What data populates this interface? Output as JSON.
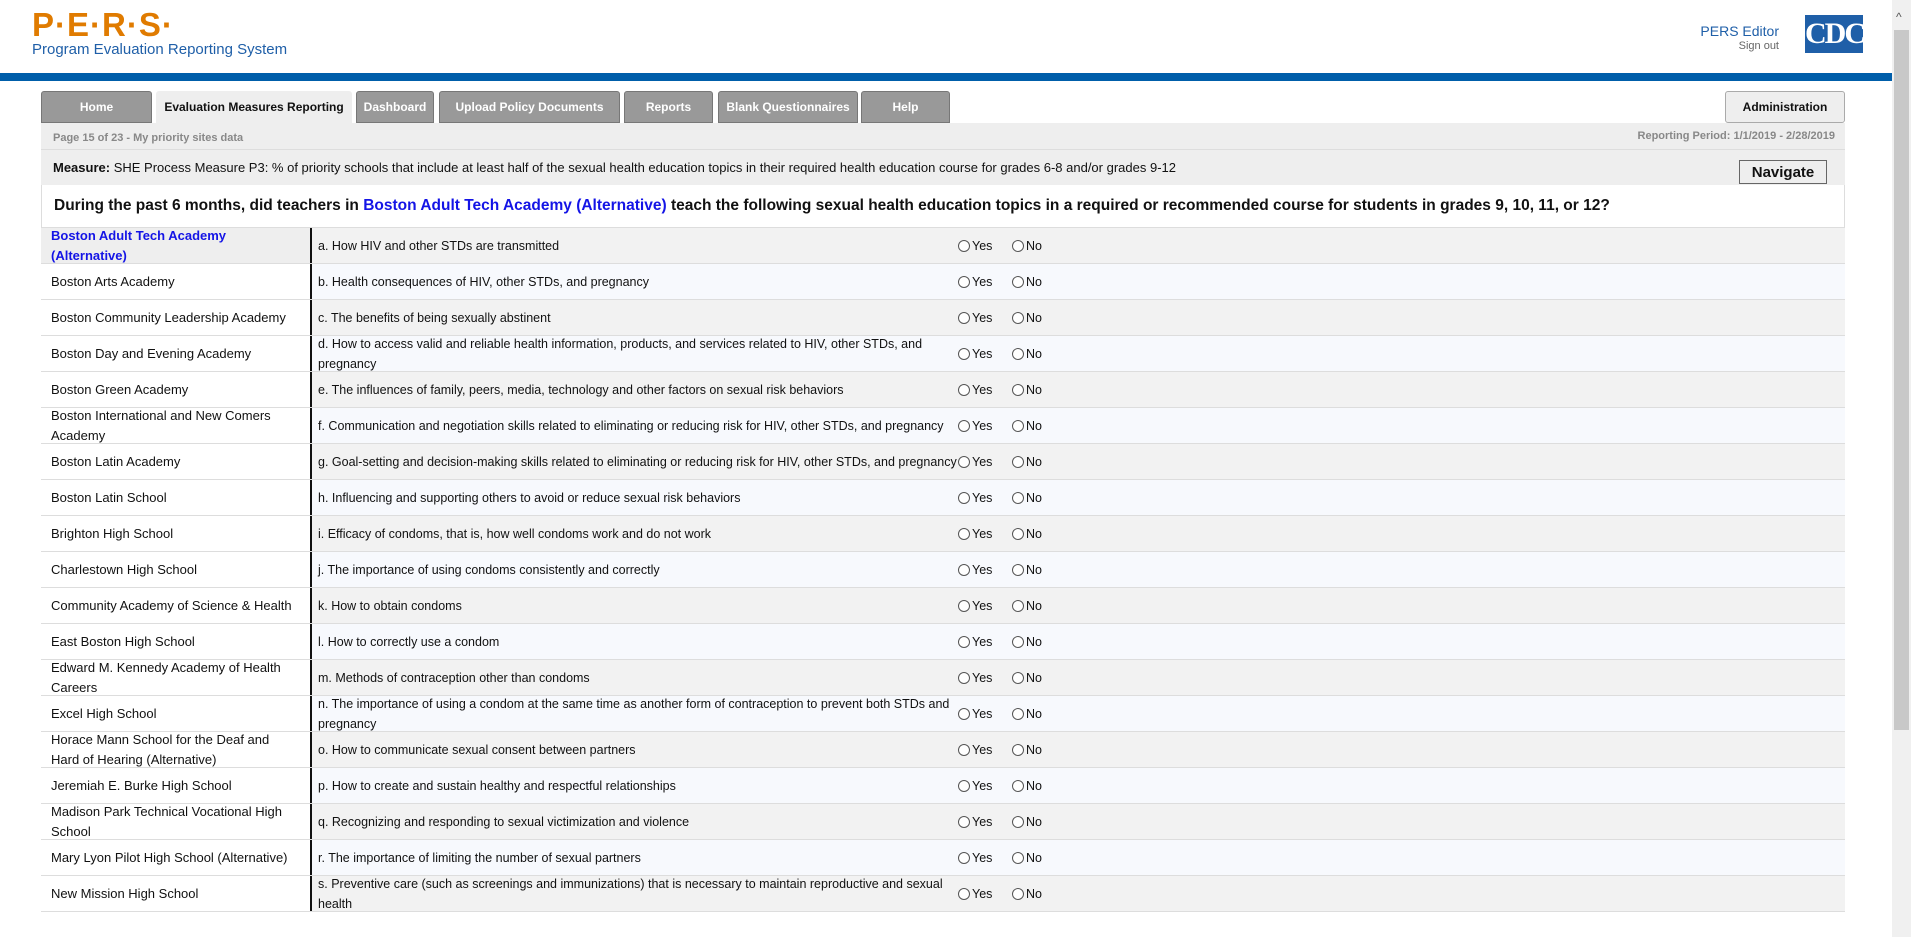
{
  "header": {
    "logo": "P·E·R·S·",
    "subtitle": "Program Evaluation Reporting System",
    "user": "PERS Editor",
    "signout": "Sign out",
    "cdc_logo": "CDC"
  },
  "tabs": [
    "Home",
    "Evaluation Measures Reporting",
    "Dashboard",
    "Upload Policy Documents",
    "Reports",
    "Blank Questionnaires",
    "Help"
  ],
  "admin_tab": "Administration",
  "page_info": "Page 15 of 23 - My priority sites data",
  "reporting_period": "Reporting Period: 1/1/2019 - 2/28/2019",
  "measure": {
    "label": "Measure:",
    "text": "SHE Process Measure P3: % of priority schools that include at least half of the sexual health education topics in their required health education course for grades 6-8 and/or grades 9-12"
  },
  "navigate": "Navigate",
  "question": {
    "pre": "During the past 6 months, did teachers in",
    "school": "Boston Adult Tech Academy (Alternative)",
    "post": "teach the following sexual health education topics in a required or recommended course for students in grades 9, 10, 11, or 12?"
  },
  "options": {
    "yes": "Yes",
    "no": "No"
  },
  "sites": [
    "Boston Adult Tech Academy (Alternative)",
    "Boston Arts Academy",
    "Boston Community Leadership Academy",
    "Boston Day and Evening Academy",
    "Boston Green Academy",
    "Boston International and New Comers Academy",
    "Boston Latin Academy",
    "Boston Latin School",
    "Brighton High School",
    "Charlestown High School",
    "Community Academy of Science & Health",
    "East Boston High School",
    "Edward M. Kennedy Academy of Health Careers",
    "Excel High School",
    "Horace Mann School for the Deaf and Hard of Hearing (Alternative)",
    "Jeremiah E. Burke High School",
    "Madison Park Technical Vocational High School",
    "Mary Lyon Pilot High School (Alternative)",
    "New Mission High School"
  ],
  "topics": [
    "a. How HIV and other STDs are transmitted",
    "b. Health consequences of HIV, other STDs, and pregnancy",
    "c. The benefits of being sexually abstinent",
    "d. How to access valid and reliable health information, products, and services related to HIV, other STDs, and pregnancy",
    "e. The influences of family, peers, media, technology and other factors on sexual risk behaviors",
    "f. Communication and negotiation skills related to eliminating or reducing risk for HIV, other STDs, and pregnancy",
    "g. Goal-setting and decision-making skills related to eliminating or reducing risk for HIV, other STDs, and pregnancy",
    "h. Influencing and supporting others to avoid or reduce sexual risk behaviors",
    "i. Efficacy of condoms, that is, how well condoms work and do not work",
    "j. The importance of using condoms consistently and correctly",
    "k. How to obtain condoms",
    "l. How to correctly use a condom",
    "m. Methods of contraception other than condoms",
    "n. The importance of using a condom at the same time as another form of contraception to prevent both STDs and pregnancy",
    "o. How to communicate sexual consent between partners",
    "p. How to create and sustain healthy and respectful relationships",
    "q. Recognizing and responding to sexual victimization and violence",
    "r. The importance of limiting the number of sexual partners",
    "s. Preventive care (such as screenings and immunizations) that is necessary to maintain reproductive and sexual health"
  ]
}
